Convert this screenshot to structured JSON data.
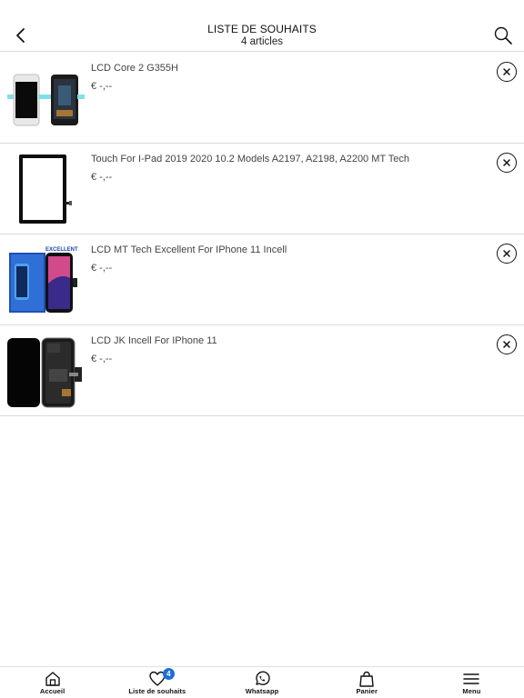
{
  "header": {
    "title": "LISTE DE SOUHAITS",
    "subtitle": "4 articles"
  },
  "items": [
    {
      "name": "LCD Core 2 G355H",
      "price": "€ -,--"
    },
    {
      "name": "Touch For I-Pad 2019  2020  10.2 Models A2197, A2198, A2200 MT Tech",
      "price": "€ -,--"
    },
    {
      "name": "LCD MT Tech Excellent For IPhone 11 Incell",
      "price": "€ -,--"
    },
    {
      "name": "LCD JK Incell For IPhone 11",
      "price": "€ -,--"
    }
  ],
  "thumb_texts": {
    "excellent": "EXCELLENT"
  },
  "tabbar": {
    "tabs": [
      {
        "label": "Accueil",
        "icon": "home-icon"
      },
      {
        "label": "Liste de souhaits",
        "icon": "heart-icon",
        "badge": "4"
      },
      {
        "label": "Whatsapp",
        "icon": "whatsapp-icon"
      },
      {
        "label": "Panier",
        "icon": "bag-icon"
      },
      {
        "label": "Menu",
        "icon": "menu-icon"
      }
    ]
  },
  "colors": {
    "badge": "#1e6fd9",
    "divider": "#d9d9d9",
    "text": "#444444"
  }
}
